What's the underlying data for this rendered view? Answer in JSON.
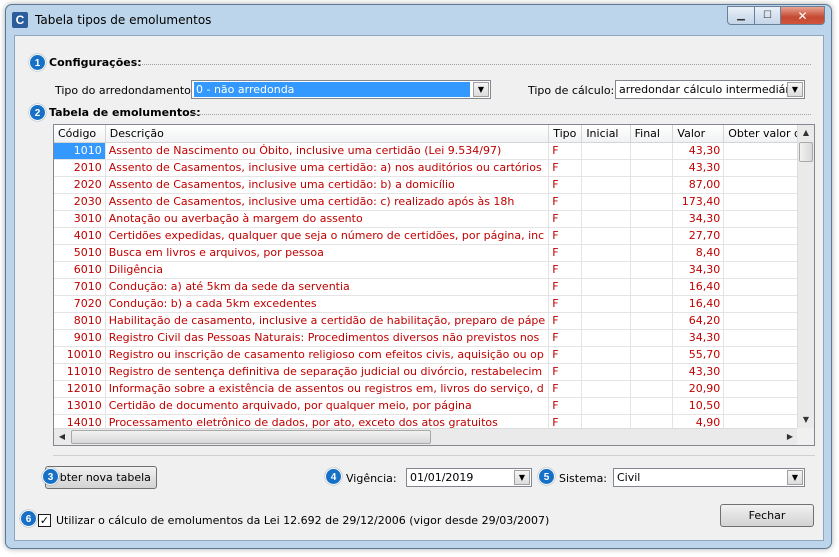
{
  "window": {
    "title": "Tabela tipos de emolumentos",
    "app_icon_letter": "C",
    "minimize": "▁",
    "maximize": "☐",
    "close": "✕"
  },
  "badges": [
    "1",
    "2",
    "3",
    "4",
    "5",
    "6"
  ],
  "config": {
    "section_label": "Configurações:",
    "rounding_label": "Tipo do arredondamento:",
    "rounding_value": "0 - não arredonda",
    "calc_label": "Tipo de cálculo:",
    "calc_value": "arredondar cálculo intermediário"
  },
  "table": {
    "section_label": "Tabela de emolumentos:",
    "columns": [
      "Código",
      "Descrição",
      "Tipo",
      "Inicial",
      "Final",
      "Valor",
      "Obter valor de"
    ],
    "rows": [
      {
        "codigo": "1010",
        "descricao": "Assento de Nascimento ou Óbito, inclusive uma certidão (Lei 9.534/97)",
        "tipo": "F",
        "inicial": "",
        "final": "",
        "valor": "43,30",
        "obter": ""
      },
      {
        "codigo": "2010",
        "descricao": "Assento de Casamentos, inclusive uma certidão: a) nos auditórios ou cartórios",
        "tipo": "F",
        "inicial": "",
        "final": "",
        "valor": "43,30",
        "obter": ""
      },
      {
        "codigo": "2020",
        "descricao": "Assento de Casamentos, inclusive uma certidão: b) a domicílio",
        "tipo": "F",
        "inicial": "",
        "final": "",
        "valor": "87,00",
        "obter": ""
      },
      {
        "codigo": "2030",
        "descricao": "Assento de Casamentos, inclusive uma certidão: c) realizado após às 18h",
        "tipo": "F",
        "inicial": "",
        "final": "",
        "valor": "173,40",
        "obter": ""
      },
      {
        "codigo": "3010",
        "descricao": "Anotação ou averbação à margem do assento",
        "tipo": "F",
        "inicial": "",
        "final": "",
        "valor": "34,30",
        "obter": ""
      },
      {
        "codigo": "4010",
        "descricao": "Certidões expedidas, qualquer que seja o número de certidões, por página, inc",
        "tipo": "F",
        "inicial": "",
        "final": "",
        "valor": "27,70",
        "obter": ""
      },
      {
        "codigo": "5010",
        "descricao": "Busca em livros e arquivos, por pessoa",
        "tipo": "F",
        "inicial": "",
        "final": "",
        "valor": "8,40",
        "obter": ""
      },
      {
        "codigo": "6010",
        "descricao": "Diligência",
        "tipo": "F",
        "inicial": "",
        "final": "",
        "valor": "34,30",
        "obter": ""
      },
      {
        "codigo": "7010",
        "descricao": "Condução: a) até 5km da sede da serventia",
        "tipo": "F",
        "inicial": "",
        "final": "",
        "valor": "16,40",
        "obter": ""
      },
      {
        "codigo": "7020",
        "descricao": "Condução: b) a cada 5km excedentes",
        "tipo": "F",
        "inicial": "",
        "final": "",
        "valor": "16,40",
        "obter": ""
      },
      {
        "codigo": "8010",
        "descricao": "Habilitação de casamento, inclusive a certidão de habilitação, preparo de pápe",
        "tipo": "F",
        "inicial": "",
        "final": "",
        "valor": "64,20",
        "obter": ""
      },
      {
        "codigo": "9010",
        "descricao": "Registro Civil das Pessoas Naturais: Procedimentos diversos não previstos nos",
        "tipo": "F",
        "inicial": "",
        "final": "",
        "valor": "34,30",
        "obter": ""
      },
      {
        "codigo": "10010",
        "descricao": "Registro ou inscrição de casamento religioso com efeitos civis, aquisição ou op",
        "tipo": "F",
        "inicial": "",
        "final": "",
        "valor": "55,70",
        "obter": ""
      },
      {
        "codigo": "11010",
        "descricao": "Registro de sentença definitiva de separação judicial ou divórcio, restabelecim",
        "tipo": "F",
        "inicial": "",
        "final": "",
        "valor": "43,30",
        "obter": ""
      },
      {
        "codigo": "12010",
        "descricao": "Informação sobre a existência de assentos ou registros em, livros do serviço, d",
        "tipo": "F",
        "inicial": "",
        "final": "",
        "valor": "20,90",
        "obter": ""
      },
      {
        "codigo": "13010",
        "descricao": "Certidão de documento arquivado, por qualquer meio, por página",
        "tipo": "F",
        "inicial": "",
        "final": "",
        "valor": "10,50",
        "obter": ""
      },
      {
        "codigo": "14010",
        "descricao": "Processamento eletrônico de dados, por ato, exceto dos atos gratuitos",
        "tipo": "F",
        "inicial": "",
        "final": "",
        "valor": "4,90",
        "obter": ""
      }
    ],
    "selected_row": 0,
    "scroll_up": "▲",
    "scroll_down": "▼",
    "scroll_left": "◀",
    "scroll_right": "▶"
  },
  "bottom": {
    "new_table_button": "Obter nova tabela",
    "vigencia_label": "Vigência:",
    "vigencia_value": "01/01/2019",
    "sistema_label": "Sistema:",
    "sistema_value": "Civil",
    "checkbox_checked": true,
    "checkbox_mark": "✓",
    "checkbox_label": "Utilizar o cálculo de emolumentos da Lei 12.692 de 29/12/2006 (vigor desde 29/03/2007)",
    "close_button": "Fechar"
  },
  "icons": {
    "dropdown": "chevron-down-icon",
    "window_close": "close-icon"
  },
  "colors": {
    "accent_badge": "#1670c6",
    "row_text": "#c00000",
    "selection": "#3399ff",
    "window_frame": "#bcd5ea"
  }
}
